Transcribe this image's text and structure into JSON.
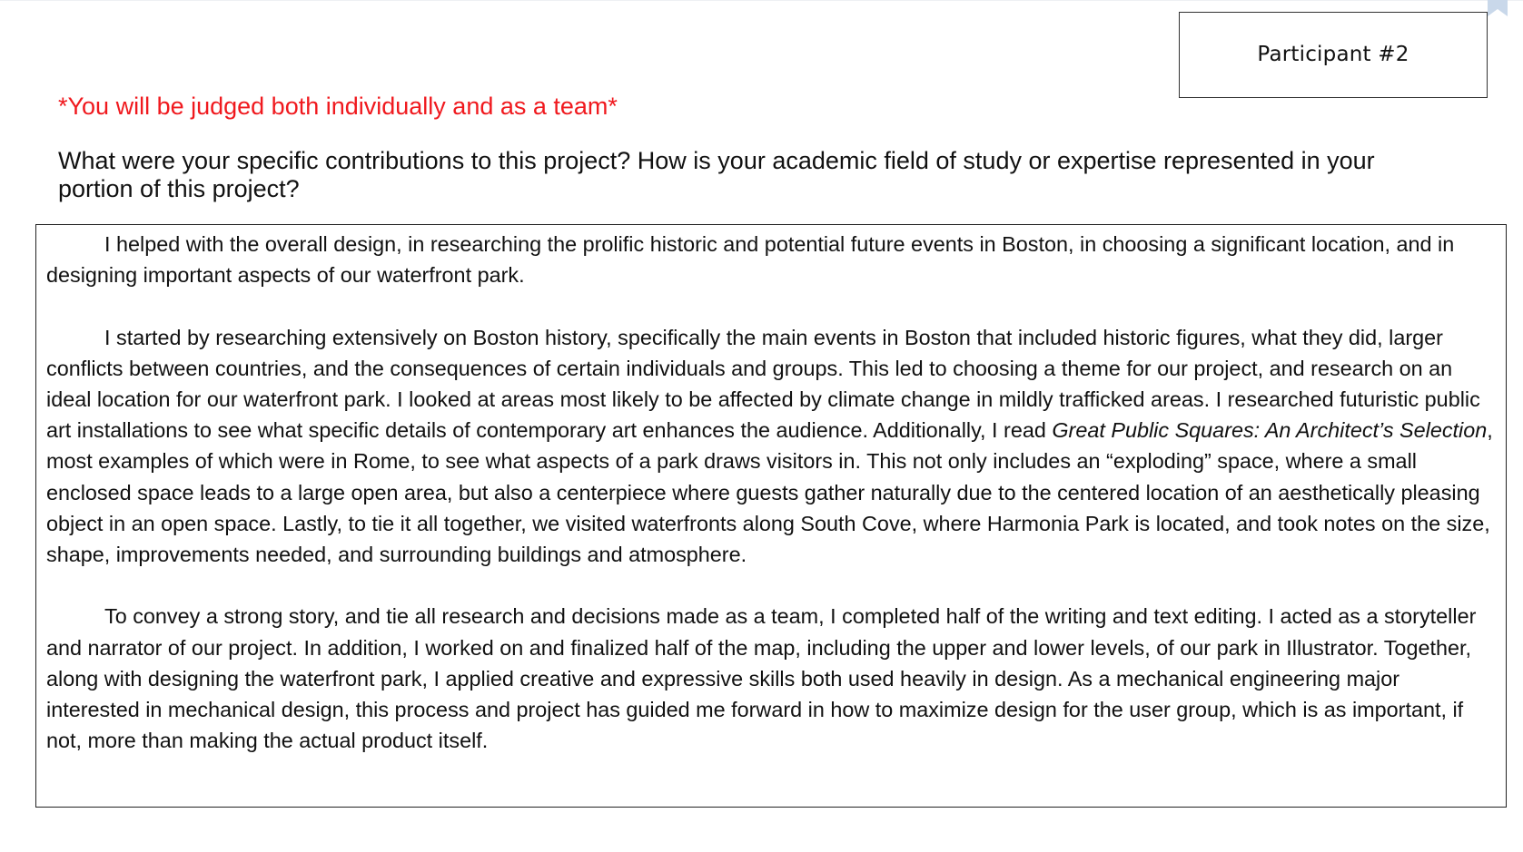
{
  "header": {
    "participant_label": "Participant #2",
    "bookmark_icon": "bookmark-corner-icon"
  },
  "instructions": {
    "judged_note": "*You will be judged both individually and as a team*",
    "question_line1": "What were your specific contributions to this project? How is your academic field of study or expertise represented in your",
    "question_line2": "portion of this project?"
  },
  "answer": {
    "para1": "I helped with the overall design, in researching the prolific historic and potential future events in Boston, in choosing a significant location, and in designing important aspects of our waterfront park.",
    "para2_before_title": "I started by researching extensively on Boston history, specifically the main events in Boston that included historic figures, what they did, larger conflicts between countries, and the consequences of certain individuals and groups. This led to choosing a theme for our project, and research on an ideal location for our waterfront park. I looked at areas most likely to be affected by climate change in mildly trafficked areas. I researched futuristic public art installations to see what specific details of contemporary art enhances the audience. Additionally, I read ",
    "para2_title": "Great Public Squares: An Architect’s Selection",
    "para2_after_title": ", most examples of which were in Rome, to see what aspects of a park draws visitors in. This not only includes an “exploding” space, where a small enclosed space leads to a large open area, but also a centerpiece where guests gather naturally due to the centered location of an aesthetically pleasing object in an open space. Lastly, to tie it all together, we visited waterfronts along South Cove, where Harmonia Park is located, and took notes on the size, shape, improvements needed, and surrounding buildings and atmosphere.",
    "para3": "To convey a strong story, and tie all research and decisions made as a team, I completed half of the writing and text editing. I acted as a storyteller and narrator of our project. In addition, I worked on and finalized half of the map, including the upper and lower levels, of our park in Illustrator.  Together, along with designing the waterfront park, I applied creative and expressive skills both used heavily in design. As a mechanical engineering major interested in mechanical design, this process and project has guided me forward in how to maximize design for the user group, which is as important, if not, more than making the actual product itself."
  },
  "colors": {
    "note_red": "#f0191e",
    "text": "#111111",
    "border": "#222222",
    "bookmark": "#c9d8ea"
  }
}
